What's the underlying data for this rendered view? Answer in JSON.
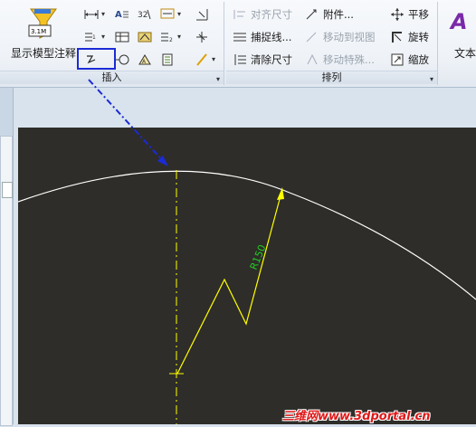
{
  "ribbon": {
    "show_model_annotations_label": "显示模型注释",
    "insert_group_label": "插入",
    "arrange_group_label": "排列",
    "arrange": {
      "align_dimensions": "对齐尺寸",
      "snap_lines": "捕捉线...",
      "clean_dimensions": "清除尺寸",
      "attachment": "附件...",
      "move_to_view": "移动到视图",
      "move_special": "移动特殊...",
      "pan": "平移",
      "rotate": "旋转",
      "scale": "缩放"
    },
    "text_style_partial": "文本",
    "insert_icons": {
      "row1": [
        "dimension-icon",
        "annotation-text-icon",
        "ordinate-dimension-icon",
        "reference-dimension-icon",
        "baseline-icon"
      ],
      "row2": [
        "datum-icon",
        "table-icon",
        "surface-finish-icon",
        "note-icon",
        "symbol-icon"
      ],
      "row3": [
        "jog-icon",
        "balloon-icon",
        "geometric-tolerance-icon",
        "datum-target-icon",
        "sketch-icon"
      ]
    }
  },
  "drawing": {
    "radius_label": "R150",
    "line_color": "#ffff00",
    "label_color": "#22cc22",
    "arc_color": "#ffffff",
    "highlight_color": "#1b2bd6"
  },
  "watermark": {
    "text": "三维网www.3dportal.cn"
  }
}
